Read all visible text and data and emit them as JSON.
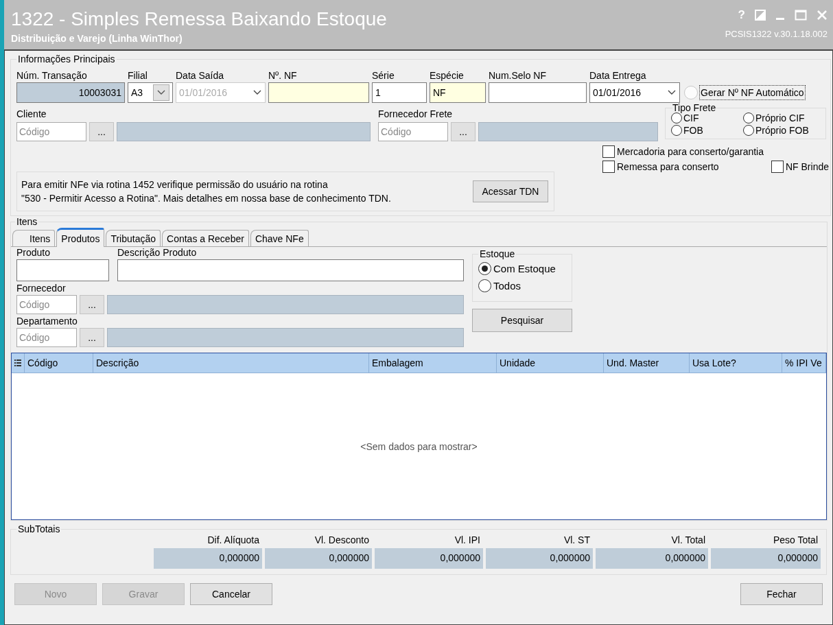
{
  "window": {
    "title": "1322 - Simples Remessa Baixando Estoque",
    "subtitle": "Distribuição e Varejo (Linha WinThor)",
    "help": "?",
    "version": "PCSIS1322  v.30.1.18.002"
  },
  "main": {
    "title": "Informações Principais",
    "fields": [
      {
        "label": "Núm. Transação",
        "value": "10003031",
        "kind": "text",
        "readonly": true,
        "required": false,
        "disabled": false
      },
      {
        "label": "Filial",
        "value": "A3",
        "kind": "combo",
        "readonly": false,
        "required": false,
        "disabled": false
      },
      {
        "label": "Data Saída",
        "value": "01/01/2016",
        "kind": "date",
        "readonly": false,
        "required": false,
        "disabled": true
      },
      {
        "label": "Nº. NF",
        "kind": "text",
        "readonly": false,
        "required": true,
        "disabled": false
      },
      {
        "label": "Série",
        "value": "1",
        "kind": "text",
        "readonly": false,
        "required": false,
        "disabled": false
      },
      {
        "label": "Espécie",
        "value": "NF",
        "kind": "text",
        "readonly": false,
        "required": true,
        "disabled": false
      },
      {
        "label": "Num.Selo NF",
        "kind": "text",
        "readonly": false,
        "required": false,
        "disabled": false
      },
      {
        "label": "Data Entrega",
        "value": "01/01/2016",
        "kind": "date",
        "readonly": false,
        "required": false,
        "disabled": false
      }
    ],
    "auto_number": {
      "label": "Gerar Nº NF Automático",
      "checked": false,
      "disabled": true
    },
    "lookups": [
      {
        "label": "Cliente",
        "placeholder": "Código",
        "button": "..."
      },
      {
        "label": "Fornecedor Frete",
        "placeholder": "Código",
        "button": "..."
      }
    ],
    "tipo_frete": {
      "title": "Tipo Frete",
      "options": [
        {
          "label": "CIF",
          "selected": false
        },
        {
          "label": "Próprio CIF",
          "selected": false
        },
        {
          "label": "FOB",
          "selected": false
        },
        {
          "label": "Próprio FOB",
          "selected": false
        }
      ]
    },
    "checkboxes": [
      {
        "label": "Mercadoria para conserto/garantia",
        "checked": false
      },
      {
        "label": "Remessa para conserto",
        "checked": false
      },
      {
        "label": "NF Brinde",
        "checked": false
      }
    ],
    "notice": {
      "text": "Para emitir NFe via rotina 1452 verifique permissão do usuário na rotina\n\"530 - Permitir Acesso a Rotina\". Mais detalhes em nossa base de conhecimento TDN.",
      "button": "Acessar TDN"
    }
  },
  "items": {
    "title": "Itens",
    "tabs": [
      {
        "label": "Itens",
        "selected": false
      },
      {
        "label": "Produtos",
        "selected": true
      },
      {
        "label": "Tributação",
        "selected": false
      },
      {
        "label": "Contas a Receber",
        "selected": false
      },
      {
        "label": "Chave NFe",
        "selected": false
      }
    ],
    "produto": {
      "label": "Produto"
    },
    "descricao": {
      "label": "Descrição Produto"
    },
    "lookups": [
      {
        "label": "Fornecedor",
        "placeholder": "Código",
        "button": "..."
      },
      {
        "label": "Departamento",
        "placeholder": "Código",
        "button": "..."
      }
    ],
    "estoque": {
      "title": "Estoque",
      "options": [
        {
          "label": "Com Estoque",
          "selected": true
        },
        {
          "label": "Todos",
          "selected": false
        }
      ]
    },
    "search_button": "Pesquisar",
    "grid": {
      "columns": [
        "Código",
        "Descrição",
        "Embalagem",
        "Unidade",
        "Und. Master",
        "Usa Lote?",
        "% IPI Ve"
      ],
      "empty": "<Sem dados para mostrar>"
    }
  },
  "subtotals": {
    "title": "SubTotais",
    "items": [
      {
        "label": "Dif. Alíquota",
        "value": "0,000000"
      },
      {
        "label": "Vl. Desconto",
        "value": "0,000000"
      },
      {
        "label": "Vl. IPI",
        "value": "0,000000"
      },
      {
        "label": "Vl. ST",
        "value": "0,000000"
      },
      {
        "label": "Vl. Total",
        "value": "0,000000"
      },
      {
        "label": "Peso Total",
        "value": "0,000000"
      }
    ]
  },
  "buttons": [
    {
      "label": "Novo",
      "disabled": true
    },
    {
      "label": "Gravar",
      "disabled": true
    },
    {
      "label": "Cancelar",
      "disabled": false
    },
    {
      "label": "Fechar",
      "disabled": false
    }
  ]
}
